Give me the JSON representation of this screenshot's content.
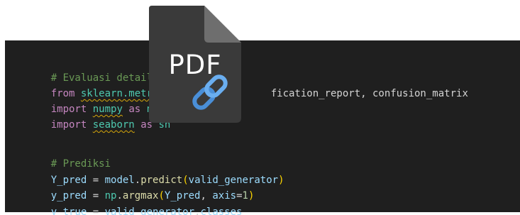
{
  "colors": {
    "editor_bg": "#1f1f1f",
    "comment": "#6a9955",
    "keyword": "#c586c0",
    "module": "#4ec9b0",
    "variable": "#9cdcfe",
    "function": "#dcdcaa",
    "bracket": "#ffd700",
    "number": "#b5cea8",
    "squiggle": "#d7a70a",
    "pdf_icon_bg": "#3c3c3c",
    "link_icon": "#4a90d9"
  },
  "code": {
    "line1": {
      "comment": "# Evaluasi detail"
    },
    "line2": {
      "kw_from": "from",
      "module": "sklearn.metrics",
      "kw_import_visible": "",
      "rest": "fication_report, confusion_matrix"
    },
    "line3": {
      "kw_import": "import",
      "module": "numpy",
      "kw_as": "as",
      "alias": "np"
    },
    "line4": {
      "kw_import": "import",
      "module": "seaborn",
      "kw_as": "as",
      "alias": "sn"
    },
    "line5": {
      "comment": "# Prediksi"
    },
    "line6": {
      "var": "Y_pred",
      "op": " = ",
      "obj": "model",
      "dot": ".",
      "func": "predict",
      "open": "(",
      "arg": "valid_generator",
      "close": ")"
    },
    "line7": {
      "var": "y_pred",
      "op": " = ",
      "obj": "np",
      "dot": ".",
      "func": "argmax",
      "open": "(",
      "arg": "Y_pred",
      "sep": ", ",
      "kwarg": "axis",
      "eq": "=",
      "num": "1",
      "close": ")"
    },
    "line8": {
      "var": "y_true",
      "op": " = ",
      "obj": "valid_generator",
      "dot": ".",
      "attr": "classes"
    }
  },
  "overlay": {
    "label": "PDF",
    "icon": "pdf-link-icon"
  }
}
